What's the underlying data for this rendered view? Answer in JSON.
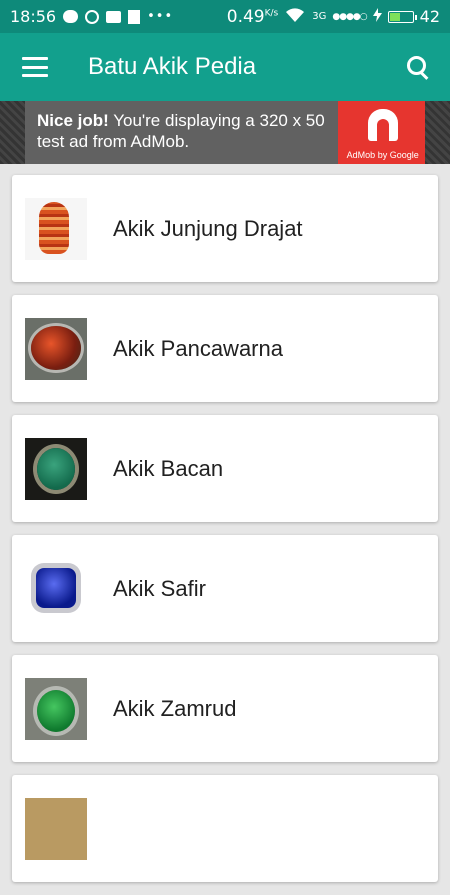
{
  "status_bar": {
    "time": "18:56",
    "speed_value": "0.49",
    "speed_unit": "K/s",
    "network": "3G",
    "signal": "●●●●○",
    "battery_level": "42",
    "battery_fraction": 0.42
  },
  "app_bar": {
    "title": "Batu Akik Pedia",
    "menu_icon": "hamburger-menu-icon",
    "search_icon": "search-icon"
  },
  "ad": {
    "bold_text": "Nice job!",
    "text": " You're displaying a 320 x 50 test ad from AdMob.",
    "logo_text": "AdMob by Google"
  },
  "items": [
    {
      "label": "Akik Junjung Drajat"
    },
    {
      "label": "Akik Pancawarna"
    },
    {
      "label": "Akik Bacan"
    },
    {
      "label": "Akik Safir"
    },
    {
      "label": "Akik Zamrud"
    },
    {
      "label": ""
    }
  ]
}
